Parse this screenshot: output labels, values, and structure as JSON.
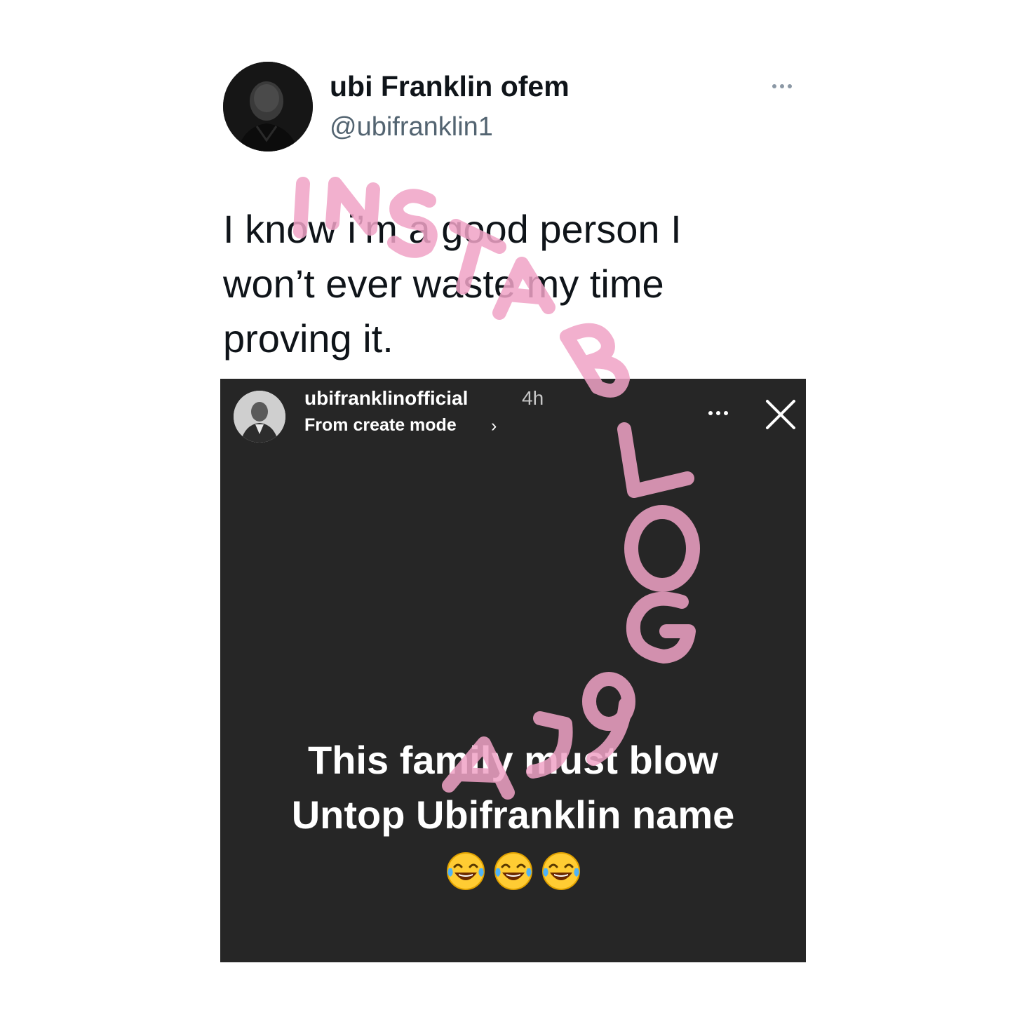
{
  "tweet": {
    "display_name": "ubi Franklin ofem",
    "handle": "@ubifranklin1",
    "text": "I know i’m a good person I won’t ever waste my time proving it.",
    "avatar_icon": "profile-photo",
    "more_icon": "more-horizontal-icon"
  },
  "story": {
    "username": "ubifranklinofficial",
    "time": "4h",
    "subtitle": "From create mode",
    "subtitle_chevron": "›",
    "caption_line1": "This family must blow",
    "caption_line2": "Untop Ubifranklin name",
    "emojis": [
      "face-with-tears-of-joy",
      "face-with-tears-of-joy",
      "face-with-tears-of-joy"
    ],
    "more_icon": "more-horizontal-icon",
    "close_icon": "close-icon",
    "background": "#262626"
  },
  "watermark": {
    "text": "INSTABLOG9JA",
    "color": "#f0a3c6"
  }
}
